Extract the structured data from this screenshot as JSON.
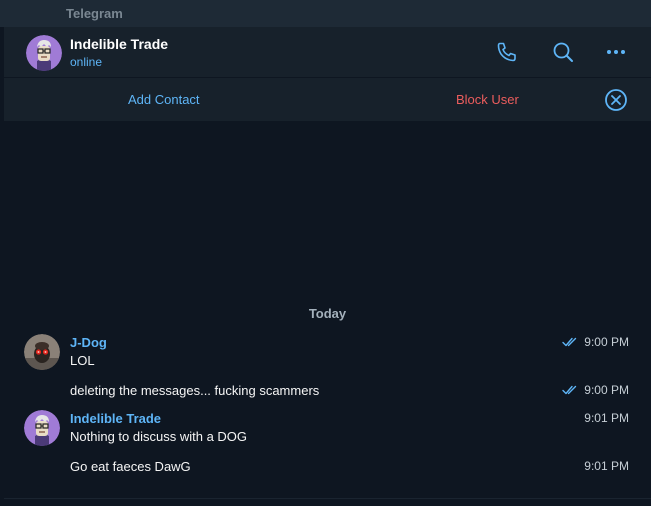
{
  "app": {
    "title": "Telegram"
  },
  "header": {
    "name": "Indelible Trade",
    "status": "online"
  },
  "actions": {
    "add_contact": "Add Contact",
    "block_user": "Block User"
  },
  "chat": {
    "date_separator": "Today",
    "groups": [
      {
        "sender": "J-Dog",
        "messages": [
          {
            "text": "LOL",
            "time": "9:00 PM",
            "read": true
          },
          {
            "text": "deleting the messages... fucking scammers",
            "time": "9:00 PM",
            "read": true
          }
        ]
      },
      {
        "sender": "Indelible Trade",
        "messages": [
          {
            "text": "Nothing to discuss with a DOG",
            "time": "9:01 PM",
            "read": false
          },
          {
            "text": "Go eat faeces DawG",
            "time": "9:01 PM",
            "read": false
          }
        ]
      }
    ]
  },
  "colors": {
    "accent": "#5eb5f7",
    "danger": "#ec5d5d",
    "background": "#0e1621",
    "panel": "#17212b"
  },
  "icons": [
    "phone-icon",
    "search-icon",
    "more-icon",
    "close-circle-icon",
    "double-check-icon"
  ]
}
